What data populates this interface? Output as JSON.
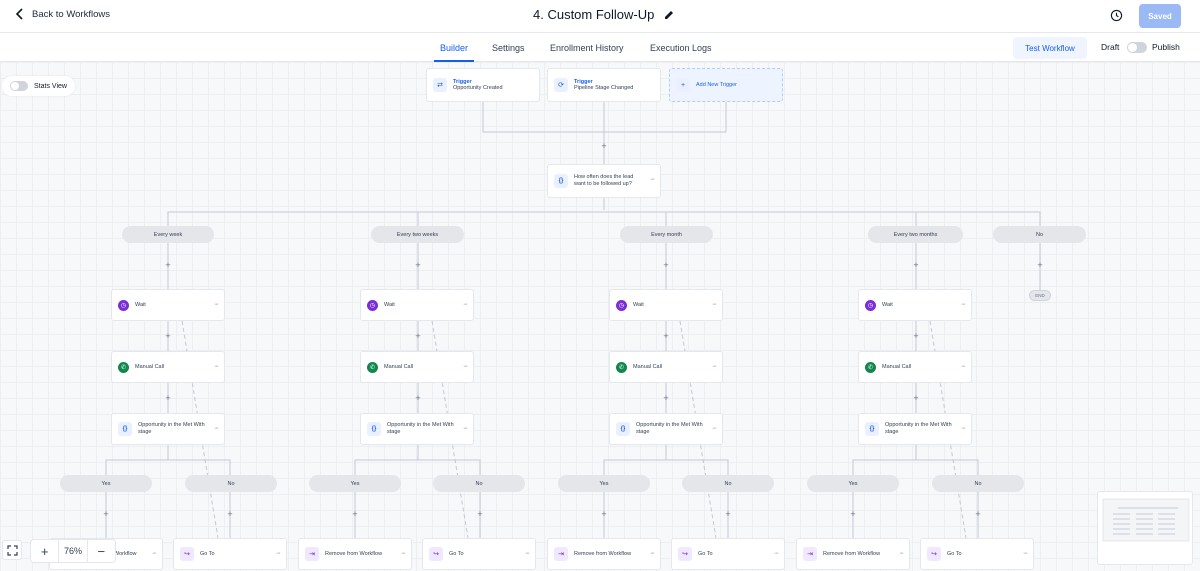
{
  "header": {
    "back_label": "Back to Workflows",
    "title": "4. Custom Follow-Up",
    "saved_label": "Saved"
  },
  "tabs": [
    {
      "label": "Builder",
      "active": true
    },
    {
      "label": "Settings",
      "active": false
    },
    {
      "label": "Enrollment History",
      "active": false
    },
    {
      "label": "Execution Logs",
      "active": false
    }
  ],
  "actions": {
    "test_label": "Test Workflow",
    "draft_label": "Draft",
    "publish_label": "Publish"
  },
  "canvas": {
    "stats_label": "Stats View",
    "triggers": [
      {
        "title": "Trigger",
        "text": "Opportunity Created"
      },
      {
        "title": "Trigger",
        "text": "Pipeline Stage Changed"
      }
    ],
    "add_trigger_label": "Add New Trigger",
    "condition_label": "How often does the lead want to be followed up?",
    "branches": [
      "Every week",
      "Every two weeks",
      "Every month",
      "Every two months",
      "No"
    ],
    "end_label": "END",
    "wait_label": "Wait",
    "call_label": "Manual Call",
    "stage_label": "Opportunity in the Met With stage",
    "yes_label": "Yes",
    "no_label": "No",
    "remove_label": "Remove from Workflow",
    "first_remove_label": "Workflow",
    "goto_label": "Go To",
    "plus": "+",
    "dots": "···"
  },
  "zoom": {
    "level": "76%",
    "plus": "+",
    "minus": "−"
  },
  "colors": {
    "accent": "#155eef",
    "wait": "#7a2ed6",
    "call": "#12874d"
  }
}
